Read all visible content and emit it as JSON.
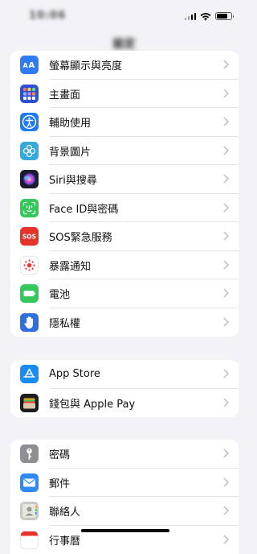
{
  "status_bar": {
    "time": "10:06",
    "battery_level": 0.8
  },
  "header": {
    "title": "設定"
  },
  "groups": [
    {
      "items": [
        {
          "label": "螢幕顯示與亮度",
          "icon": "display-brightness-icon",
          "color": "#2f7cf6"
        },
        {
          "label": "主畫面",
          "icon": "home-screen-icon",
          "color": "#2d4fd6"
        },
        {
          "label": "輔助使用",
          "icon": "accessibility-icon",
          "color": "#1d7cf2"
        },
        {
          "label": "背景圖片",
          "icon": "wallpaper-icon",
          "color": "#36aadc"
        },
        {
          "label": "Siri與搜尋",
          "icon": "siri-icon",
          "color": "#1c1c2e"
        },
        {
          "label": "Face ID與密碼",
          "icon": "face-id-icon",
          "color": "#34c759"
        },
        {
          "label": "SOS緊急服務",
          "icon": "sos-icon",
          "color": "#e5332a"
        },
        {
          "label": "暴露通知",
          "icon": "exposure-notification-icon",
          "color": "#ffffff"
        },
        {
          "label": "電池",
          "icon": "battery-icon",
          "color": "#34c759"
        },
        {
          "label": "隱私權",
          "icon": "privacy-hand-icon",
          "color": "#2f6fe0"
        }
      ]
    },
    {
      "items": [
        {
          "label": "App Store",
          "icon": "app-store-icon",
          "color": "#1a8cf5"
        },
        {
          "label": "錢包與 Apple Pay",
          "icon": "wallet-icon",
          "color": "#1c1c1e"
        }
      ]
    },
    {
      "items": [
        {
          "label": "密碼",
          "icon": "key-icon",
          "color": "#8e8e93"
        },
        {
          "label": "郵件",
          "icon": "mail-icon",
          "color": "#2f8af6"
        },
        {
          "label": "聯絡人",
          "icon": "contacts-icon",
          "color": "#c9c7c2"
        },
        {
          "label": "行事曆",
          "icon": "calendar-icon",
          "color": "#e5332a"
        }
      ]
    }
  ]
}
